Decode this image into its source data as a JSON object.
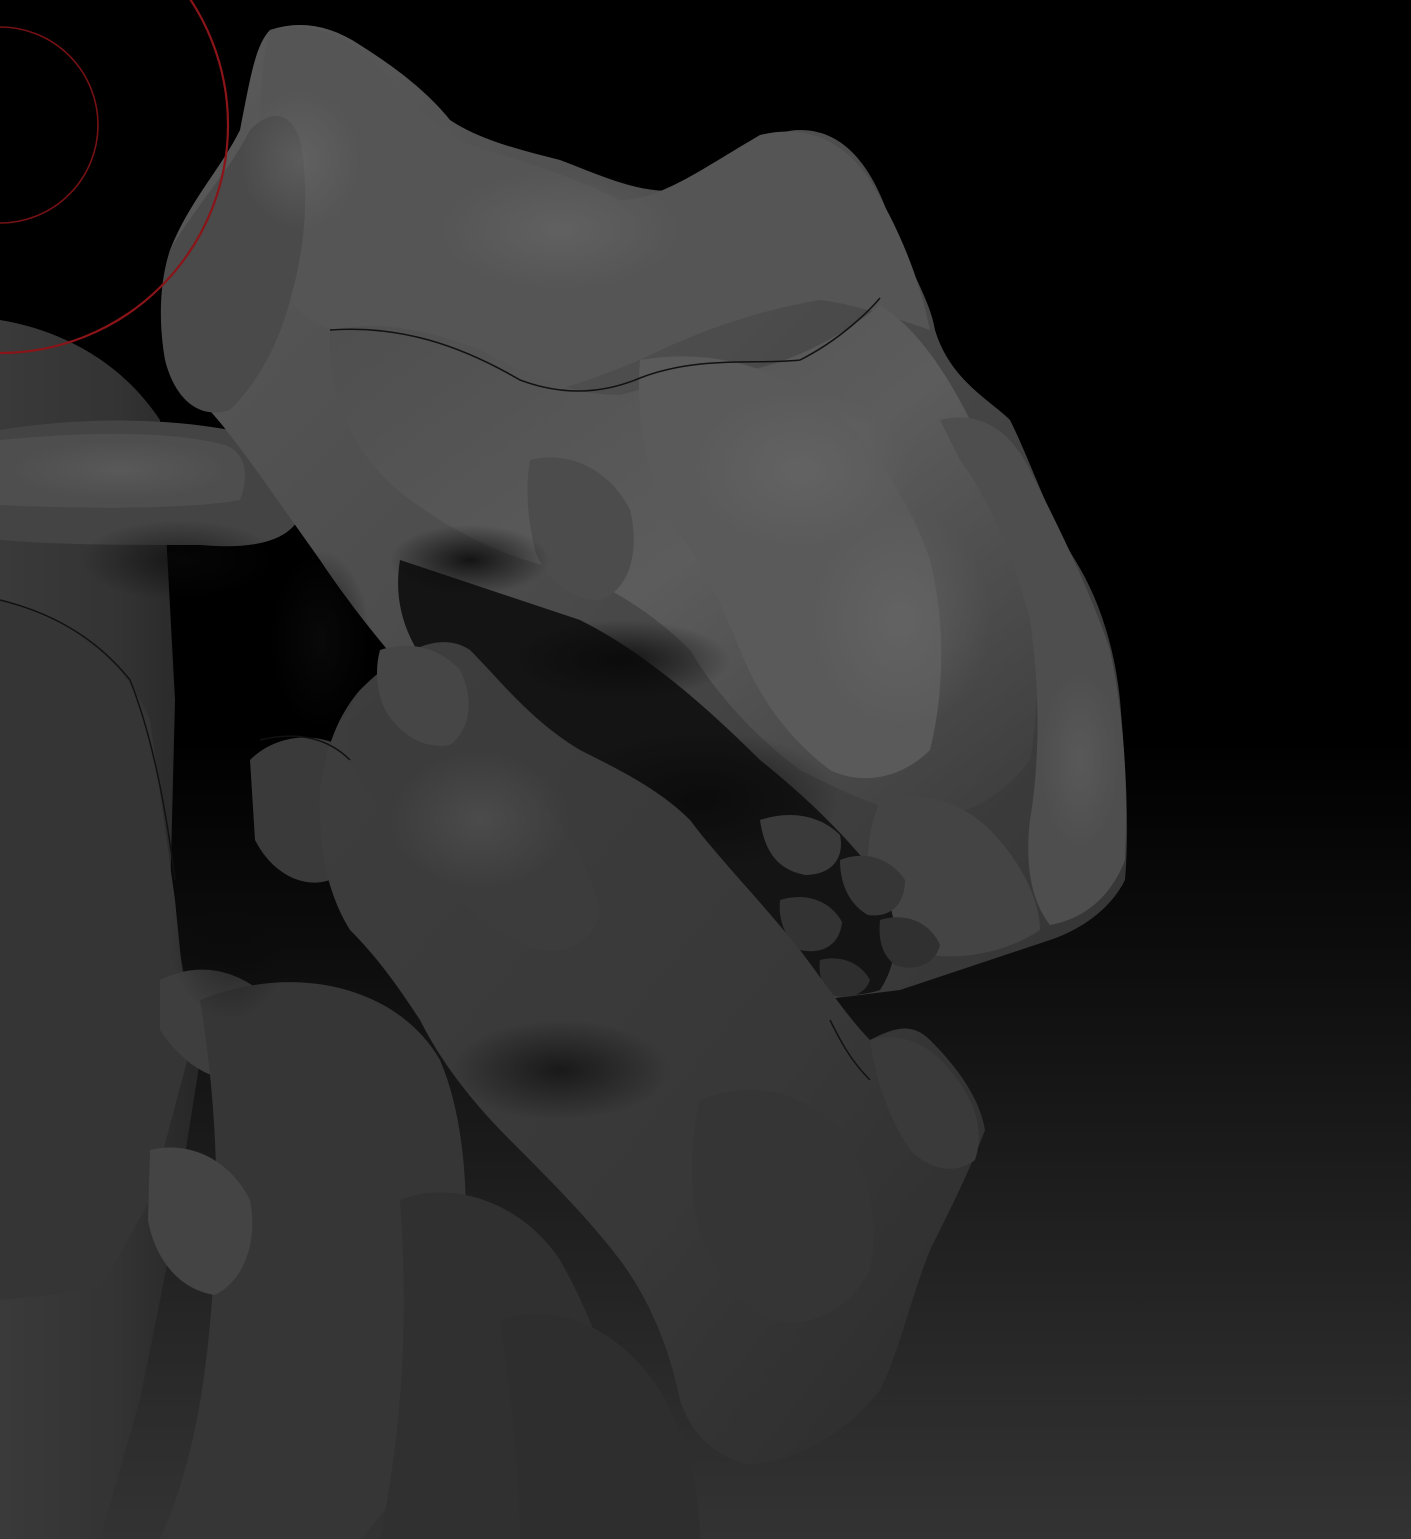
{
  "viewport": {
    "background_top": "#000000",
    "background_bottom": "#333333"
  },
  "model": {
    "material_color": "#4a4a4a",
    "highlight_color": "#6a6a6a",
    "shadow_color": "#1a1a1a"
  },
  "brush_cursor": {
    "color": "#8a1418",
    "shape": "double-circle"
  }
}
